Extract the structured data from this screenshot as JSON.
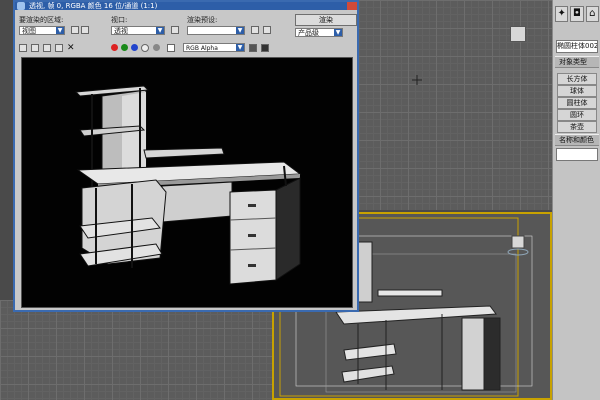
{
  "render_window": {
    "title": "透视, 帧 0, RGBA 颜色 16 位/通道 (1:1)",
    "area_label": "要渲染的区域:",
    "area_value": "视图",
    "viewport_label": "视口:",
    "viewport_value": "透视",
    "preset_label": "渲染预设:",
    "preset_value": "",
    "render_button": "渲染",
    "production_value": "产品级",
    "channel_value": "RGB Alpha"
  },
  "command_panel": {
    "name_field": "椭圆柱体002",
    "object_type_header": "对象类型",
    "primitives": [
      "长方体",
      "球体",
      "圆柱体",
      "圆环",
      "茶壶"
    ],
    "name_color_header": "名称和颜色"
  },
  "colors": {
    "title_blue": "#2d5ea8",
    "viewport_gray": "#5c5c5c",
    "active_viewport_border": "#c8a200",
    "render_bg": "#020202"
  }
}
